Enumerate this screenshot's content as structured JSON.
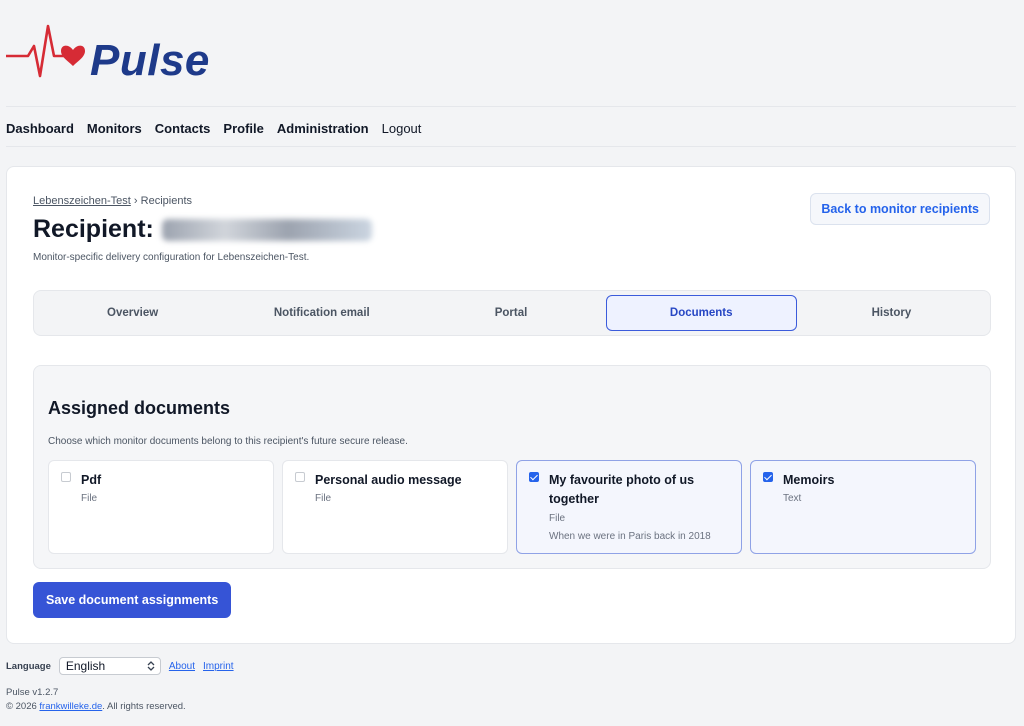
{
  "brand": {
    "name": "Pulse",
    "accent": "#1e3a8a",
    "heart_color": "#d62b35"
  },
  "nav": {
    "items": [
      "Dashboard",
      "Monitors",
      "Contacts",
      "Profile",
      "Administration"
    ],
    "logout": "Logout"
  },
  "breadcrumb": {
    "monitor": "Lebenszeichen-Test",
    "separator": "›",
    "current": "Recipients"
  },
  "page": {
    "title_prefix": "Recipient:",
    "subtitle": "Monitor-specific delivery configuration for Lebenszeichen-Test.",
    "back_button": "Back to monitor recipients"
  },
  "tabs": [
    {
      "label": "Overview",
      "active": false
    },
    {
      "label": "Notification email",
      "active": false
    },
    {
      "label": "Portal",
      "active": false
    },
    {
      "label": "Documents",
      "active": true
    },
    {
      "label": "History",
      "active": false
    }
  ],
  "documents_section": {
    "title": "Assigned documents",
    "description": "Choose which monitor documents belong to this recipient's future secure release.",
    "documents": [
      {
        "name": "Pdf",
        "type": "File",
        "note": "",
        "checked": false
      },
      {
        "name": "Personal audio message",
        "type": "File",
        "note": "",
        "checked": false
      },
      {
        "name": "My favourite photo of us together",
        "type": "File",
        "note": "When we were in Paris back in 2018",
        "checked": true
      },
      {
        "name": "Memoirs",
        "type": "Text",
        "note": "",
        "checked": true
      }
    ],
    "save_button": "Save document assignments"
  },
  "footer": {
    "language_label": "Language",
    "language_value": "English",
    "about": "About",
    "imprint": "Imprint",
    "version": "Pulse v1.2.7",
    "copyright_prefix": "© 2026",
    "copyright_link": "frankwilleke.de",
    "copyright_suffix": ". All rights reserved."
  }
}
